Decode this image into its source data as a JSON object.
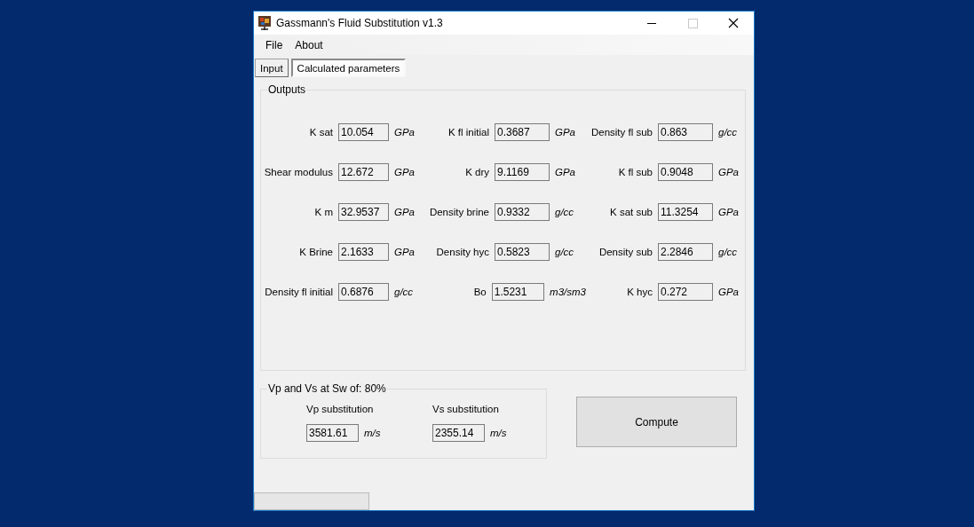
{
  "window": {
    "title": "Gassmann's Fluid Substitution v1.3"
  },
  "menu": [
    {
      "label": "File"
    },
    {
      "label": "About"
    }
  ],
  "tabs": [
    {
      "label": "Input",
      "selected": false
    },
    {
      "label": "Calculated parameters",
      "selected": true
    }
  ],
  "outputs": {
    "title": "Outputs",
    "rows": [
      [
        {
          "label": "K sat",
          "value": "10.054",
          "unit": "GPa"
        },
        {
          "label": "K fl initial",
          "value": "0.3687",
          "unit": "GPa"
        },
        {
          "label": "Density fl sub",
          "value": "0.863",
          "unit": "g/cc"
        }
      ],
      [
        {
          "label": "Shear modulus",
          "value": "12.672",
          "unit": "GPa"
        },
        {
          "label": "K dry",
          "value": "9.1169",
          "unit": "GPa"
        },
        {
          "label": "K fl sub",
          "value": "0.9048",
          "unit": "GPa"
        }
      ],
      [
        {
          "label": "K m",
          "value": "32.9537",
          "unit": "GPa"
        },
        {
          "label": "Density brine",
          "value": "0.9332",
          "unit": "g/cc"
        },
        {
          "label": "K sat sub",
          "value": "11.3254",
          "unit": "GPa"
        }
      ],
      [
        {
          "label": "K Brine",
          "value": "2.1633",
          "unit": "GPa"
        },
        {
          "label": "Density hyc",
          "value": "0.5823",
          "unit": "g/cc"
        },
        {
          "label": "Density sub",
          "value": "2.2846",
          "unit": "g/cc"
        }
      ],
      [
        {
          "label": "Density fl initial",
          "value": "0.6876",
          "unit": "g/cc"
        },
        {
          "label": "Bo",
          "value": "1.5231",
          "unit": "m3/sm3"
        },
        {
          "label": "K hyc",
          "value": "0.272",
          "unit": "GPa"
        }
      ]
    ]
  },
  "velocities": {
    "title": "Vp and Vs at Sw of: 80%",
    "items": [
      {
        "label": "Vp substitution",
        "value": "3581.61",
        "unit": "m/s"
      },
      {
        "label": "Vs substitution",
        "value": "2355.14",
        "unit": "m/s"
      }
    ]
  },
  "compute_button": {
    "label": "Compute"
  },
  "progress_bar": {
    "level": 0
  }
}
